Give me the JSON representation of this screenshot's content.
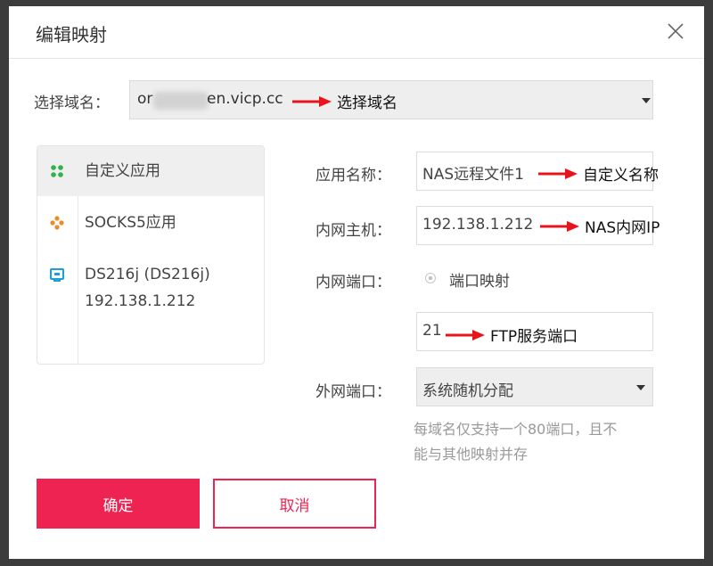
{
  "dialog": {
    "title": "编辑映射",
    "close_icon": "close-icon"
  },
  "domain": {
    "label": "选择域名：",
    "value_prefix": "or",
    "value_suffix": "en.vicp.cc",
    "annotation": "选择域名"
  },
  "sidebar": {
    "items": [
      {
        "label": "自定义应用",
        "icon": "custom-app-icon",
        "active": true
      },
      {
        "label": "SOCKS5应用",
        "icon": "socks5-icon",
        "active": false
      },
      {
        "label_line1": "DS216j (DS216j)",
        "label_line2": "192.138.1.212",
        "icon": "nas-device-icon",
        "active": false
      }
    ]
  },
  "form": {
    "app_name": {
      "label": "应用名称：",
      "value": "NAS远程文件1",
      "annotation": "自定义名称"
    },
    "internal_host": {
      "label": "内网主机：",
      "value": "192.138.1.212",
      "annotation": "NAS内网IP"
    },
    "internal_port": {
      "label": "内网端口：",
      "radio_label": "端口映射",
      "value": "21",
      "annotation": "FTP服务端口"
    },
    "external_port": {
      "label": "外网端口：",
      "selected": "系统随机分配",
      "hint_line1": "每域名仅支持一个80端口，且不",
      "hint_line2": "能与其他映射并存"
    }
  },
  "buttons": {
    "confirm": "确定",
    "cancel": "取消"
  },
  "colors": {
    "accent": "#ee2352",
    "annotation_arrow": "#e8141c",
    "custom_icon": "#2fb24d",
    "socks_icon": "#f08a24",
    "device_icon": "#1aa0d8"
  }
}
